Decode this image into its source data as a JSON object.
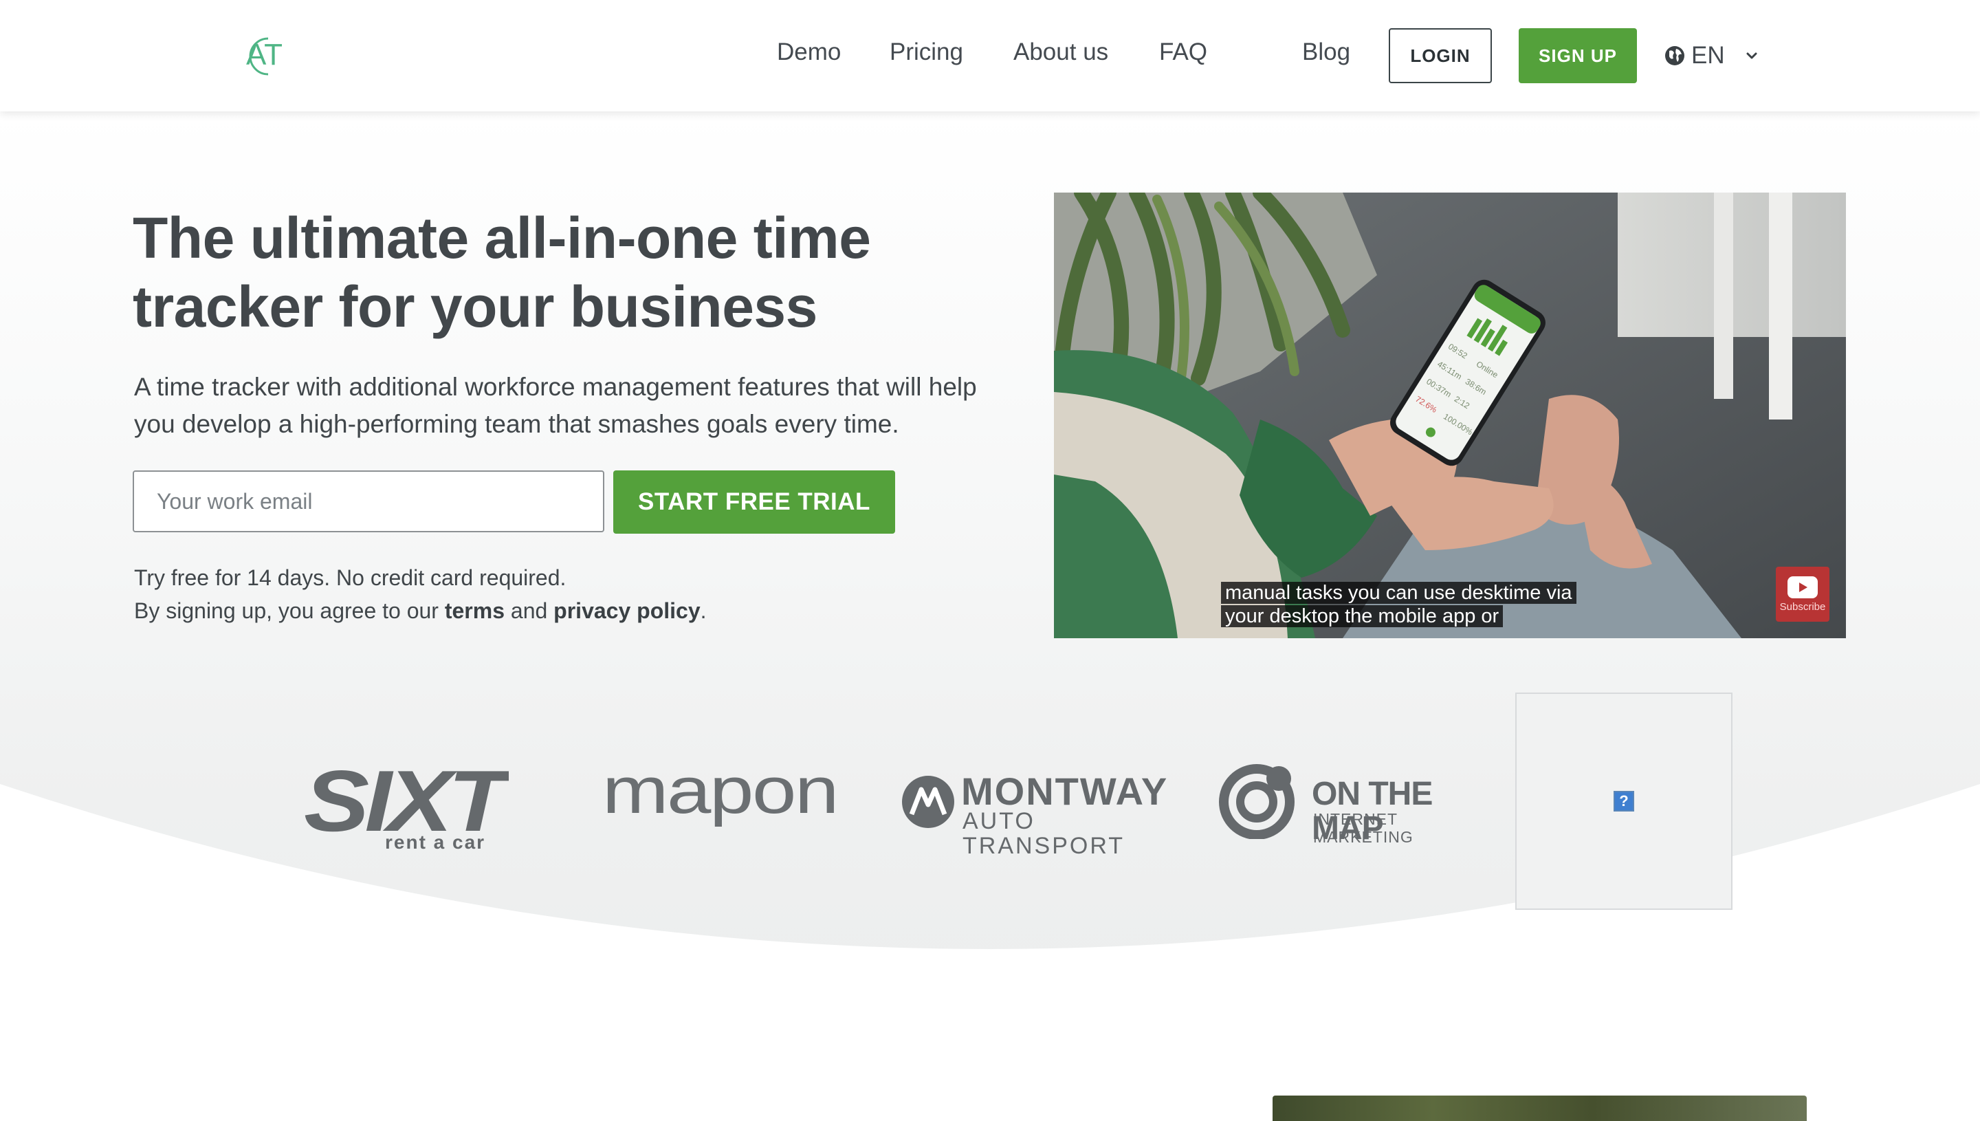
{
  "header": {
    "logo_alt": "AT",
    "nav": [
      "Demo",
      "Pricing",
      "About us",
      "FAQ",
      "Blog"
    ],
    "login_label": "LOGIN",
    "signup_label": "SIGN UP",
    "language": "EN"
  },
  "hero": {
    "title": "The ultimate all-in-one time tracker for your business",
    "subtitle": "A time tracker with additional workforce management features that will help you develop a high-performing team that smashes goals every time.",
    "email_placeholder": "Your work email",
    "cta_label": "START FREE TRIAL",
    "note_line1": "Try free for 14 days. No credit card required.",
    "note_line2_prefix": "By signing up, you agree to our ",
    "terms_label": "terms",
    "and_label": " and ",
    "privacy_label": "privacy policy",
    "period": "."
  },
  "video": {
    "caption_line1": "manual tasks you can use desktime via",
    "caption_line2": "your desktop the mobile app or",
    "subscribe_label": "Subscribe",
    "phone_stats": [
      "09:52",
      "Online",
      "45:11m",
      "38:6m",
      "00:37m",
      "2:12",
      "72.6%",
      "100.00%"
    ]
  },
  "clients": {
    "sixt_main": "SIXT",
    "sixt_sub": "rent a car",
    "mapon": "mapon",
    "montway_main": "MONTWAY",
    "montway_sub": "AUTO TRANSPORT",
    "onthemap_main": "ON THE MAP",
    "onthemap_sub": "INTERNET MARKETING",
    "placeholder_icon": "?"
  },
  "colors": {
    "brand_green": "#54a13b",
    "text_dark": "#42474b",
    "logo_gray": "#6b6f72",
    "logo_teal": "#4fb585"
  }
}
